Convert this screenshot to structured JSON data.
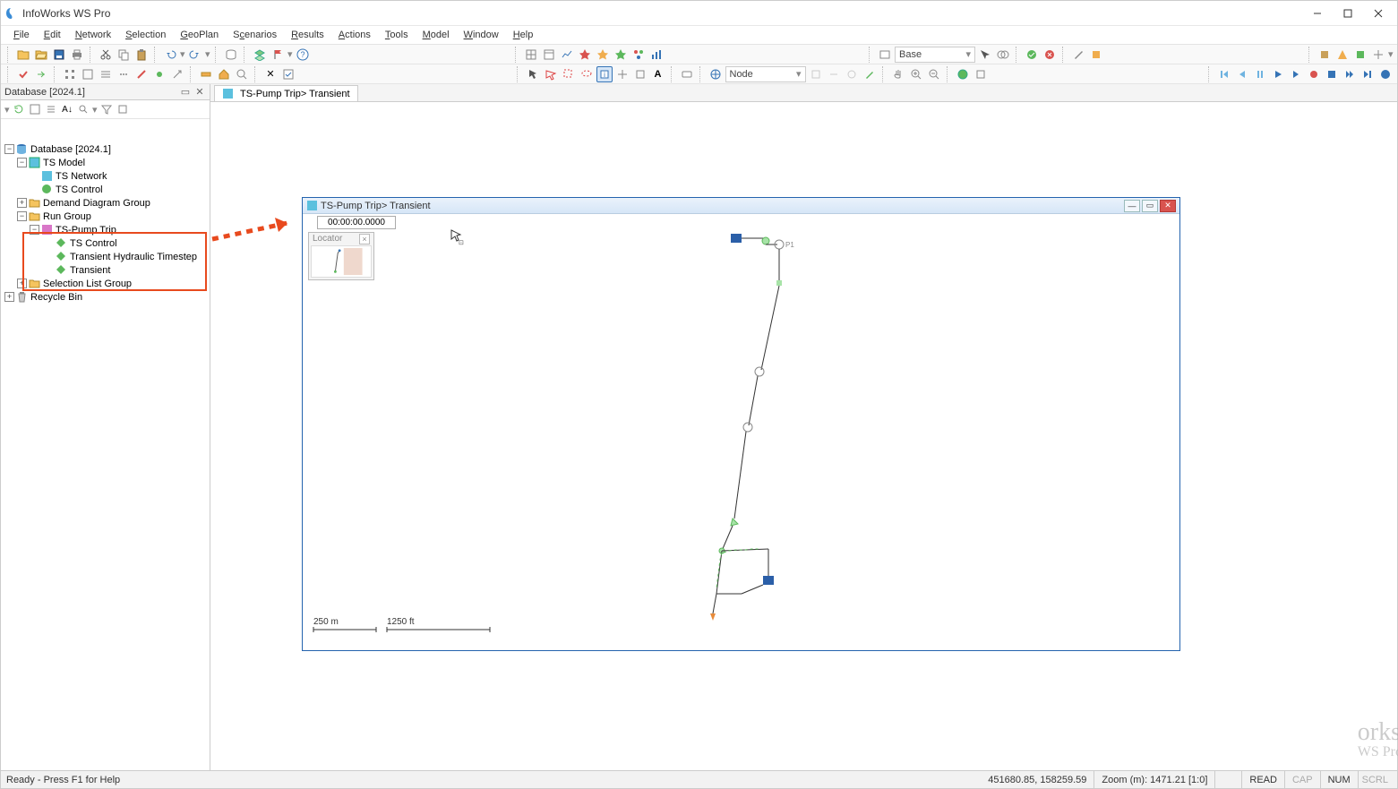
{
  "app": {
    "title": "InfoWorks WS Pro"
  },
  "menu": [
    {
      "l": "File",
      "m": "F"
    },
    {
      "l": "Edit",
      "m": "E"
    },
    {
      "l": "Network",
      "m": "N"
    },
    {
      "l": "Selection",
      "m": "S"
    },
    {
      "l": "GeoPlan",
      "m": "G"
    },
    {
      "l": "Scenarios",
      "m": "c"
    },
    {
      "l": "Results",
      "m": "R"
    },
    {
      "l": "Actions",
      "m": "A"
    },
    {
      "l": "Tools",
      "m": "T"
    },
    {
      "l": "Model",
      "m": "M"
    },
    {
      "l": "Window",
      "m": "W"
    },
    {
      "l": "Help",
      "m": "H"
    }
  ],
  "toolbar2_scenario": "Base",
  "toolbar3_target": "Node",
  "db_panel": {
    "title": "Database [2024.1]"
  },
  "tree": {
    "root": "Database [2024.1]",
    "model": "TS Model",
    "network": "TS Network",
    "control": "TS Control",
    "ddg": "Demand Diagram Group",
    "rungroup": "Run Group",
    "run": "TS-Pump Trip",
    "run_ctrl": "TS Control",
    "run_tht": "Transient Hydraulic Timestep",
    "run_trans": "Transient",
    "slg": "Selection List Group",
    "bin": "Recycle Bin"
  },
  "tab": "TS-Pump Trip> Transient",
  "floatwin": {
    "title": "TS-Pump Trip> Transient",
    "time": "00:00:00.0000",
    "locator": "Locator",
    "scale_m": "250 m",
    "scale_ft": "1250 ft"
  },
  "watermark": {
    "big": "orks",
    "sub": "WS Pro"
  },
  "status": {
    "ready": "Ready - Press F1 for Help",
    "coords": "451680.85, 158259.59",
    "zoom": "Zoom (m): 1471.21 [1:0]",
    "read": "READ",
    "cap": "CAP",
    "num": "NUM",
    "scrl": "SCRL"
  }
}
